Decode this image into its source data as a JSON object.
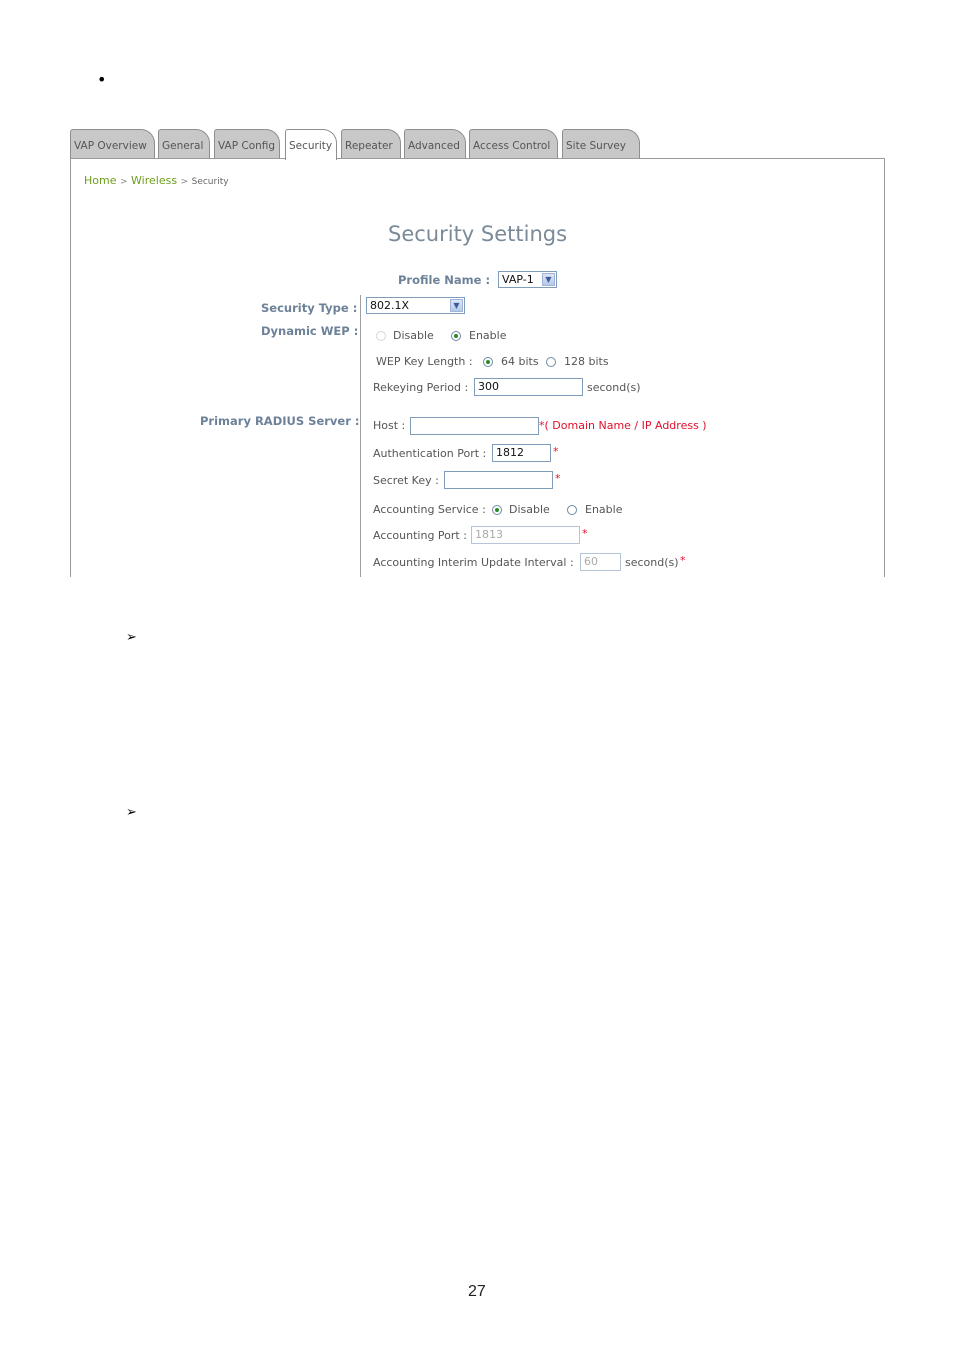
{
  "document": {
    "bullet": "•",
    "arrow_bullets": [
      "➢",
      "➢"
    ],
    "page_number": "27"
  },
  "tabs": [
    {
      "label": "VAP Overview",
      "active": false
    },
    {
      "label": "General",
      "active": false
    },
    {
      "label": "VAP Config",
      "active": false
    },
    {
      "label": "Security",
      "active": true
    },
    {
      "label": "Repeater",
      "active": false
    },
    {
      "label": "Advanced",
      "active": false
    },
    {
      "label": "Access Control",
      "active": false
    },
    {
      "label": "Site Survey",
      "active": false
    }
  ],
  "breadcrumb": {
    "home": "Home",
    "sep": ">",
    "wireless": "Wireless",
    "current": "Security"
  },
  "page_title": "Security Settings",
  "profile": {
    "label": "Profile Name :",
    "value": "VAP-1"
  },
  "security_type": {
    "label": "Security Type :",
    "value": "802.1X"
  },
  "dynamic_wep": {
    "label": "Dynamic WEP :",
    "options": [
      "Disable",
      "Enable"
    ],
    "selected": "Enable",
    "key_length_label": "WEP Key Length :",
    "key_length_options": [
      "64 bits",
      "128 bits"
    ],
    "key_length_selected": "64 bits",
    "rekey_label": "Rekeying Period :",
    "rekey_value": "300",
    "rekey_unit": "second(s)"
  },
  "radius": {
    "label": "Primary RADIUS Server :",
    "host_label": "Host :",
    "host_value": "",
    "host_hint": "*( Domain Name / IP Address )",
    "auth_port_label": "Authentication Port :",
    "auth_port_value": "1812",
    "secret_label": "Secret Key :",
    "secret_value": "",
    "required_mark": "*",
    "acct_service_label": "Accounting Service :",
    "acct_service_options": [
      "Disable",
      "Enable"
    ],
    "acct_service_selected": "Disable",
    "acct_port_label": "Accounting Port :",
    "acct_port_value": "1813",
    "interim_label": "Accounting Interim Update Interval :",
    "interim_value": "60",
    "interim_unit": "second(s)"
  },
  "colors": {
    "label_blue": "#6d8299",
    "breadcrumb_green": "#6e9d1e",
    "required_red": "#e0102c",
    "tab_gray": "#c8c8c8"
  }
}
